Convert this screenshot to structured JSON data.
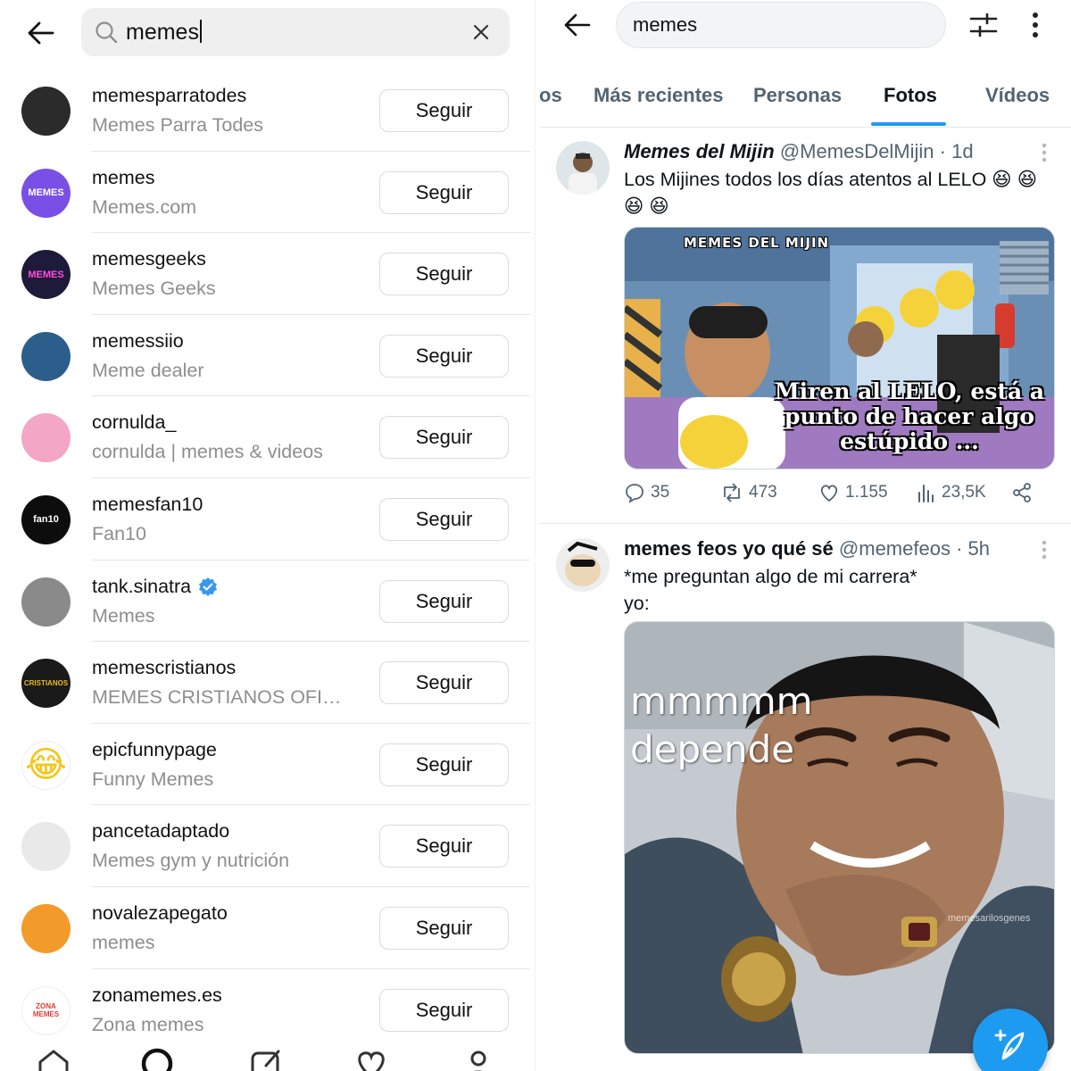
{
  "instagram": {
    "search": {
      "query": "memes"
    },
    "results": [
      {
        "username": "memesparratodes",
        "subtitle": "Memes Parra Todes",
        "follow_label": "Seguir",
        "verified": false,
        "avatar": {
          "bg": "#2b2b2b",
          "fg": "#f2c94c",
          "glyph": ""
        }
      },
      {
        "username": "memes",
        "subtitle": "Memes.com",
        "follow_label": "Seguir",
        "verified": false,
        "avatar": {
          "bg": "#7a4fe6",
          "fg": "#ffffff",
          "glyph": "MEMES"
        }
      },
      {
        "username": "memesgeeks",
        "subtitle": "Memes Geeks",
        "follow_label": "Seguir",
        "verified": false,
        "avatar": {
          "bg": "#1d1a3a",
          "fg": "#ff4fd8",
          "glyph": "MEMES"
        }
      },
      {
        "username": "memessiio",
        "subtitle": "Meme dealer",
        "follow_label": "Seguir",
        "verified": false,
        "avatar": {
          "bg": "#2c5e8c",
          "fg": "#ffffff",
          "glyph": ""
        }
      },
      {
        "username": "cornulda_",
        "subtitle": "cornulda | memes & videos",
        "follow_label": "Seguir",
        "verified": false,
        "avatar": {
          "bg": "#f4a6c6",
          "fg": "#222222",
          "glyph": ""
        }
      },
      {
        "username": "memesfan10",
        "subtitle": "Fan10",
        "follow_label": "Seguir",
        "verified": false,
        "avatar": {
          "bg": "#0d0d0d",
          "fg": "#ffffff",
          "glyph": "fan10"
        }
      },
      {
        "username": "tank.sinatra",
        "subtitle": "Memes",
        "follow_label": "Seguir",
        "verified": true,
        "avatar": {
          "bg": "#8a8a8a",
          "fg": "#ffffff",
          "glyph": ""
        }
      },
      {
        "username": "memescristianos",
        "subtitle": "MEMES CRISTIANOS OFICI...",
        "follow_label": "Seguir",
        "verified": false,
        "avatar": {
          "bg": "#1a1a1a",
          "fg": "#e8b923",
          "glyph": "CRISTIANOS"
        }
      },
      {
        "username": "epicfunnypage",
        "subtitle": "Funny Memes",
        "follow_label": "Seguir",
        "verified": false,
        "avatar": {
          "bg": "#ffffff",
          "fg": "#f5c518",
          "glyph": "😂"
        }
      },
      {
        "username": "pancetadaptado",
        "subtitle": "Memes gym y nutrición",
        "follow_label": "Seguir",
        "verified": false,
        "avatar": {
          "bg": "#e9e9e9",
          "fg": "#333333",
          "glyph": ""
        }
      },
      {
        "username": "novalezapegato",
        "subtitle": "memes",
        "follow_label": "Seguir",
        "verified": false,
        "avatar": {
          "bg": "#f29b2b",
          "fg": "#5a2d0c",
          "glyph": ""
        }
      },
      {
        "username": "zonamemes.es",
        "subtitle": "Zona memes",
        "follow_label": "Seguir",
        "verified": false,
        "avatar": {
          "bg": "#ffffff",
          "fg": "#e63b2e",
          "glyph": "ZONA MEMES"
        }
      }
    ]
  },
  "twitter": {
    "search": {
      "query": "memes"
    },
    "tabs": [
      {
        "label": "os",
        "active": false
      },
      {
        "label": "Más recientes",
        "active": false
      },
      {
        "label": "Personas",
        "active": false
      },
      {
        "label": "Fotos",
        "active": true
      },
      {
        "label": "Vídeos",
        "active": false
      }
    ],
    "posts": [
      {
        "display_name": "Memes del Mijin",
        "handle": "@MemesDelMijin",
        "time": "1d",
        "text": "Los Mijines todos los días atentos al LELO 😆 😆 😆 😆",
        "image_watermark": "MEMES DEL MIJIN",
        "image_caption": "Miren al LELO, está a punto de hacer algo estúpido ...",
        "stats": {
          "replies": "35",
          "retweets": "473",
          "likes": "1.155",
          "views": "23,5K"
        }
      },
      {
        "display_name": "memes feos yo qué sé",
        "handle": "@memefeos",
        "time": "5h",
        "text_line1": "*me preguntan algo de mi carrera*",
        "text_line2": "yo:",
        "image_caption_line1": "mmmmm",
        "image_caption_line2": "depende",
        "image_watermark": "memesarilosgenes"
      }
    ]
  },
  "colors": {
    "twitter_blue": "#1d9bf0",
    "muted_gray": "#8e8e8e",
    "tw_muted": "#536471"
  }
}
